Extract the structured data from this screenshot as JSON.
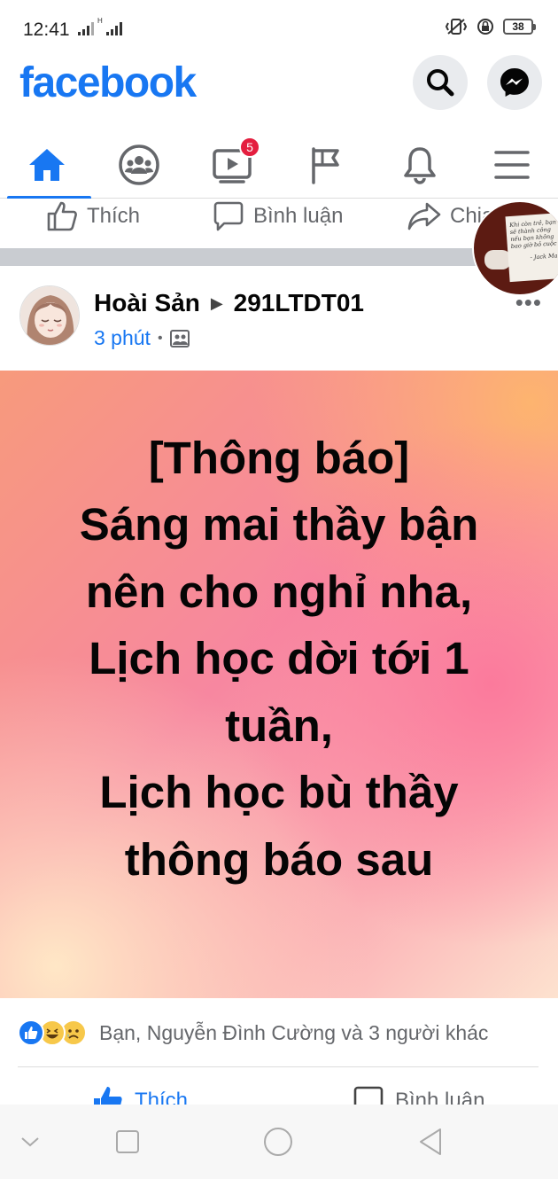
{
  "status_bar": {
    "time": "12:41",
    "network_label": "H",
    "battery": "38"
  },
  "header": {
    "logo": "facebook",
    "search_icon": "search-icon",
    "messenger_icon": "messenger-icon"
  },
  "nav": {
    "items": [
      {
        "name": "home",
        "icon": "home-icon",
        "active": true
      },
      {
        "name": "groups",
        "icon": "groups-icon"
      },
      {
        "name": "watch",
        "icon": "video-icon",
        "badge": "5"
      },
      {
        "name": "pages",
        "icon": "flag-icon"
      },
      {
        "name": "notifications",
        "icon": "bell-icon"
      },
      {
        "name": "menu",
        "icon": "hamburger-icon"
      }
    ]
  },
  "previous_post": {
    "like_label": "Thích",
    "comment_label": "Bình luận",
    "share_label": "Chia"
  },
  "chat_head": {
    "quote_text": "Khi còn trẻ, bạn sẽ thành công nếu bạn không bao giờ bỏ cuộc",
    "quote_author": "- Jack Ma -"
  },
  "post": {
    "author": "Hoài Sản",
    "group": "291LTDT01",
    "time": "3 phút",
    "privacy_icon": "group-privacy-icon",
    "text_lines": [
      "[Thông báo]",
      "Sáng mai thầy bận",
      "nên cho nghỉ nha,",
      "Lịch học dời tới 1",
      "tuần,",
      "Lịch học bù thầy",
      "thông báo sau"
    ],
    "reactions_text": "Bạn, Nguyễn Đình Cường và 3 người khác",
    "reaction_icons": [
      "like-reaction-icon",
      "haha-reaction-icon",
      "sad-reaction-icon"
    ],
    "like_label": "Thích",
    "comment_label": "Bình luận"
  },
  "colors": {
    "brand": "#1877f2",
    "badge": "#e41e3f",
    "secondary_text": "#65676b"
  },
  "system_nav": [
    "back-chevron-icon",
    "recents-icon",
    "home-circle-icon",
    "back-triangle-icon"
  ]
}
